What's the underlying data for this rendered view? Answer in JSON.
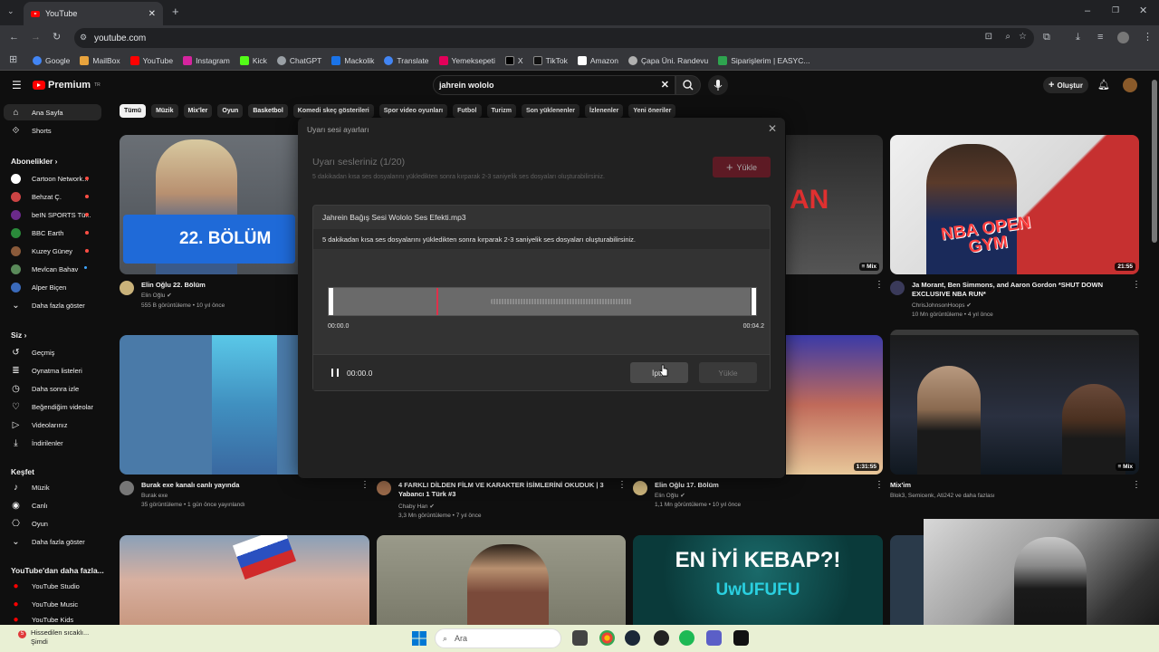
{
  "browser": {
    "tab_title": "YouTube",
    "url": "youtube.com",
    "bookmarks": [
      {
        "label": "Google",
        "color": "#4285f4"
      },
      {
        "label": "MailBox",
        "color": "#e8a33d"
      },
      {
        "label": "YouTube",
        "color": "#ff0000"
      },
      {
        "label": "Instagram",
        "color": "#d6249f"
      },
      {
        "label": "Kick",
        "color": "#53fc18"
      },
      {
        "label": "ChatGPT",
        "color": "#9aa0a6"
      },
      {
        "label": "Mackolik",
        "color": "#1a73e8"
      },
      {
        "label": "Translate",
        "color": "#4285f4"
      },
      {
        "label": "Yemeksepeti",
        "color": "#e3005a"
      },
      {
        "label": "X",
        "color": "#000000"
      },
      {
        "label": "TikTok",
        "color": "#111111"
      },
      {
        "label": "Amazon",
        "color": "#ffffff"
      },
      {
        "label": "Çapa Üni. Randevu",
        "color": "#b0b0b0"
      },
      {
        "label": "Siparişlerim | EASYC...",
        "color": "#2ea44f"
      }
    ]
  },
  "header": {
    "logo_text": "Premium",
    "logo_region": "TR",
    "search_query": "jahrein wololo",
    "create_label": "Oluştur"
  },
  "sidebar": {
    "main": [
      {
        "label": "Ana Sayfa",
        "icon": "home-icon"
      },
      {
        "label": "Shorts",
        "icon": "shorts-icon"
      }
    ],
    "subs_heading": "Abonelikler",
    "subs": [
      {
        "label": "Cartoon Network...",
        "color": "#ffffff",
        "live": true
      },
      {
        "label": "Behzat Ç.",
        "color": "#c44",
        "live": true
      },
      {
        "label": "beIN SPORTS Tü...",
        "color": "#6a2a8a",
        "live": true
      },
      {
        "label": "BBC Earth",
        "color": "#2a8a3a",
        "live": true
      },
      {
        "label": "Kuzey Güney",
        "color": "#8a5a3a",
        "live": true
      },
      {
        "label": "Mevlcan Bahav",
        "color": "#5a8a5a",
        "live": false
      },
      {
        "label": "Alper Biçen",
        "color": "#3a6aba",
        "live": false
      }
    ],
    "show_more": "Daha fazla göster",
    "you_heading": "Siz",
    "you": [
      {
        "label": "Geçmiş",
        "icon": "history-icon"
      },
      {
        "label": "Oynatma listeleri",
        "icon": "playlist-icon"
      },
      {
        "label": "Daha sonra izle",
        "icon": "clock-icon"
      },
      {
        "label": "Beğendiğim videolar",
        "icon": "like-icon"
      },
      {
        "label": "Videolarınız",
        "icon": "video-icon"
      },
      {
        "label": "İndirilenler",
        "icon": "download-icon"
      }
    ],
    "explore_heading": "Keşfet",
    "explore": [
      {
        "label": "Müzik",
        "icon": "music-icon"
      },
      {
        "label": "Canlı",
        "icon": "live-icon"
      },
      {
        "label": "Oyun",
        "icon": "gaming-icon"
      },
      {
        "label": "Daha fazla göster",
        "icon": "chevron-down-icon"
      }
    ],
    "more_heading": "YouTube'dan daha fazla...",
    "more": [
      {
        "label": "YouTube Studio"
      },
      {
        "label": "YouTube Music"
      },
      {
        "label": "YouTube Kids"
      }
    ]
  },
  "chips": [
    "Tümü",
    "Müzik",
    "Mix'ler",
    "Oyun",
    "Basketbol",
    "Komedi skeç gösterileri",
    "Spor video oyunları",
    "Futbol",
    "Turizm",
    "Son yüklenenler",
    "İzlenenler",
    "Yeni öneriler"
  ],
  "videos": {
    "v1": {
      "title": "Elin Oğlu 22. Bölüm",
      "channel": "Elin Oğlu",
      "meta": "555 B görüntüleme • 10 yıl önce",
      "thumb_text": "22. BÖLÜM"
    },
    "v2": {
      "title": "Ja Morant, Ben Simmons, and Aaron Gordon *SHUT DOWN EXCLUSIVE NBA RUN*",
      "channel": "ChrisJohnsonHoops",
      "meta": "10 Mn görüntüleme • 4 yıl önce",
      "duration": "21:55",
      "thumb_text": "NBA OPEN GYM"
    },
    "v3": {
      "title": "Burak exe kanalı canlı yayında",
      "channel": "Burak exe",
      "meta": "35 görüntüleme • 1 gün önce yayınlandı"
    },
    "v4": {
      "title": "4 FARKLI DİLDEN FİLM VE KARAKTER İSİMLERİNİ OKUDUK | 3 Yabancı 1 Türk #3",
      "channel": "Chaby Han",
      "meta": "3,3 Mn görüntüleme • 7 yıl önce"
    },
    "v5": {
      "title": "Elin Oğlu 17. Bölüm",
      "channel": "Elin Oğlu",
      "meta": "1,1 Mn görüntüleme • 10 yıl önce",
      "duration": "1:31:55"
    },
    "v6": {
      "title": "Mix'im",
      "meta": "Blok3, Semicenk, Ati242 ve daha fazlası",
      "duration": "Mix"
    },
    "v7": {
      "thumb_text": "EN İYİ KEBAP?!",
      "thumb_sub": "UwUFUFU"
    },
    "mix_badge": "Mix"
  },
  "modal": {
    "title": "Uyarı sesi ayarları",
    "heading": "Uyarı sesleriniz (1/20)",
    "subtitle": "5 dakikadan kısa ses dosyalarını yükledikten sonra kırparak 2-3 saniyelik ses dosyaları oluşturabilirsiniz.",
    "upload_label": "Yükle",
    "file_name": "Jahrein Bağış Sesi Wololo Ses Efekti.mp3",
    "info": "5 dakikadan kısa ses dosyalarını yükledikten sonra kırparak 2-3 saniyelik ses dosyaları oluşturabilirsiniz.",
    "start_time": "00:00.0",
    "end_time": "00:04.2",
    "current_time": "00:00.0",
    "cancel_label": "İptal",
    "upload2_label": "Yükle"
  },
  "taskbar": {
    "weather_line1": "Hissedilen sıcaklı...",
    "weather_line2": "Şimdi",
    "weather_badge": "5",
    "search_placeholder": "Ara"
  }
}
